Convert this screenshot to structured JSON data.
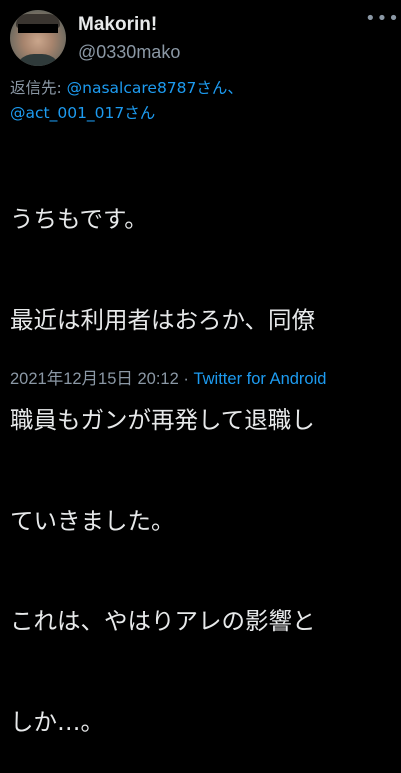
{
  "author": {
    "display_name": "Makorin!",
    "handle": "@0330mako"
  },
  "reply": {
    "prefix": "返信先: ",
    "mention1": "@nasalcare8787さん、",
    "mention2": "@act_001_017さん"
  },
  "tweet": {
    "lines": [
      "うちもです。",
      "最近は利用者はおろか、同僚",
      "職員もガンが再発して退職し",
      "ていきました。",
      "これは、やはりアレの影響と",
      "しか…。"
    ]
  },
  "meta": {
    "timestamp": "2021年12月15日 20:12",
    "separator": " · ",
    "source": "Twitter for Android"
  },
  "icons": {
    "more": "more-horizontal-icon",
    "avatar": "profile-avatar"
  },
  "colors": {
    "background": "#000000",
    "text": "#e7e9ea",
    "secondary": "#8b98a5",
    "link": "#1d9bf0"
  }
}
